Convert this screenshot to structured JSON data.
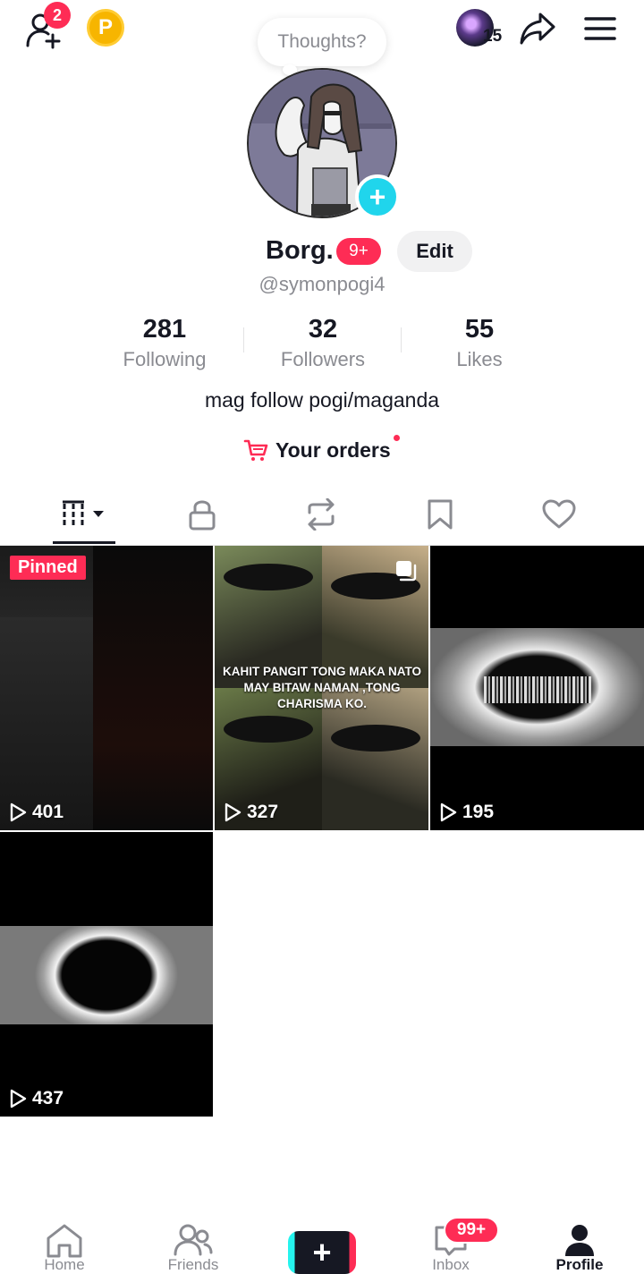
{
  "header": {
    "add_friend_badge": "2",
    "coin_label": "P",
    "story_count": "15",
    "thoughts_placeholder": "Thoughts?"
  },
  "profile": {
    "display_name": "Borg.",
    "name_badge": "9+",
    "edit_label": "Edit",
    "username": "@symonpogi4",
    "bio": "mag follow pogi/maganda",
    "orders_label": "Your orders"
  },
  "stats": [
    {
      "value": "281",
      "label": "Following"
    },
    {
      "value": "32",
      "label": "Followers"
    },
    {
      "value": "55",
      "label": "Likes"
    }
  ],
  "tabs": [
    "videos-grid-icon",
    "lock-icon",
    "repost-icon",
    "bookmark-icon",
    "heart-icon"
  ],
  "videos": [
    {
      "views": "401",
      "pinned_label": "Pinned"
    },
    {
      "views": "327",
      "caption_lines": [
        "KAHIT PANGIT TONG MAKA NATO",
        "MAY BITAW NAMAN ,TONG",
        "CHARISMA KO."
      ]
    },
    {
      "views": "195"
    },
    {
      "views": "437"
    }
  ],
  "bottom_nav": {
    "home": "Home",
    "friends": "Friends",
    "create": "+",
    "inbox": "Inbox",
    "inbox_badge": "99+",
    "profile": "Profile"
  },
  "colors": {
    "accent": "#fe2c55",
    "cyan": "#20d5ec",
    "text": "#161823",
    "muted": "#8a8b91"
  }
}
